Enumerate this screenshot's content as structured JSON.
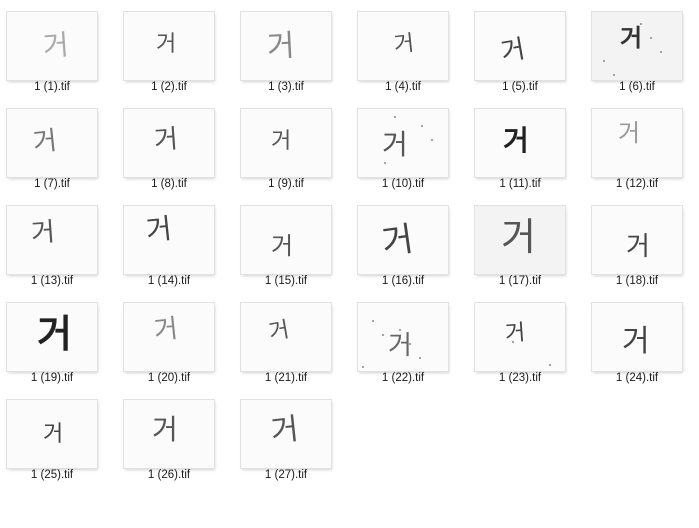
{
  "files": [
    {
      "name": "1 (1).tif",
      "glyph": "거"
    },
    {
      "name": "1 (2).tif",
      "glyph": "거"
    },
    {
      "name": "1 (3).tif",
      "glyph": "거"
    },
    {
      "name": "1 (4).tif",
      "glyph": "거"
    },
    {
      "name": "1 (5).tif",
      "glyph": "거"
    },
    {
      "name": "1 (6).tif",
      "glyph": "거"
    },
    {
      "name": "1 (7).tif",
      "glyph": "거"
    },
    {
      "name": "1 (8).tif",
      "glyph": "거"
    },
    {
      "name": "1 (9).tif",
      "glyph": "거"
    },
    {
      "name": "1 (10).tif",
      "glyph": "거"
    },
    {
      "name": "1 (11).tif",
      "glyph": "거"
    },
    {
      "name": "1 (12).tif",
      "glyph": "거"
    },
    {
      "name": "1 (13).tif",
      "glyph": "거"
    },
    {
      "name": "1 (14).tif",
      "glyph": "거"
    },
    {
      "name": "1 (15).tif",
      "glyph": "거"
    },
    {
      "name": "1 (16).tif",
      "glyph": "거"
    },
    {
      "name": "1 (17).tif",
      "glyph": "거"
    },
    {
      "name": "1 (18).tif",
      "glyph": "거"
    },
    {
      "name": "1 (19).tif",
      "glyph": "거"
    },
    {
      "name": "1 (20).tif",
      "glyph": "거"
    },
    {
      "name": "1 (21).tif",
      "glyph": "거"
    },
    {
      "name": "1 (22).tif",
      "glyph": "거"
    },
    {
      "name": "1 (23).tif",
      "glyph": "거"
    },
    {
      "name": "1 (24).tif",
      "glyph": "거"
    },
    {
      "name": "1 (25).tif",
      "glyph": "거"
    },
    {
      "name": "1 (26).tif",
      "glyph": "거"
    },
    {
      "name": "1 (27).tif",
      "glyph": "거"
    }
  ],
  "colors": {
    "background": "#ffffff",
    "label_text": "#1a1a1a",
    "thumbnail_border": "#e1e1e1",
    "ink": "#444444"
  }
}
